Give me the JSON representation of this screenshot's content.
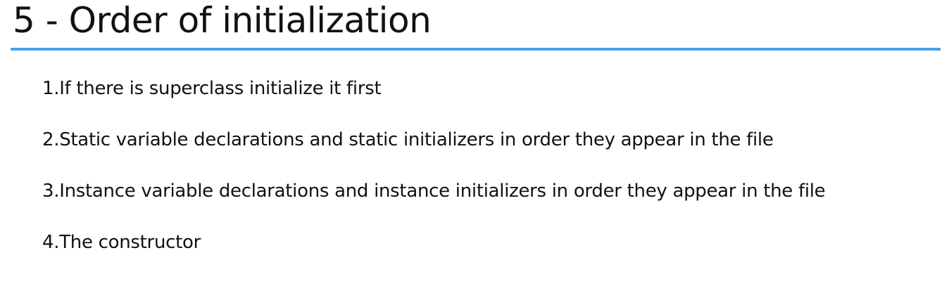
{
  "slide": {
    "title": "5 - Order of initialization",
    "accent_color": "#4a9fe8",
    "steps": [
      "1.If there is superclass initialize it first",
      "2.Static variable declarations and static initializers in order they appear in the file",
      "3.Instance variable declarations and instance initializers in order they appear in the file",
      "4.The constructor"
    ]
  }
}
